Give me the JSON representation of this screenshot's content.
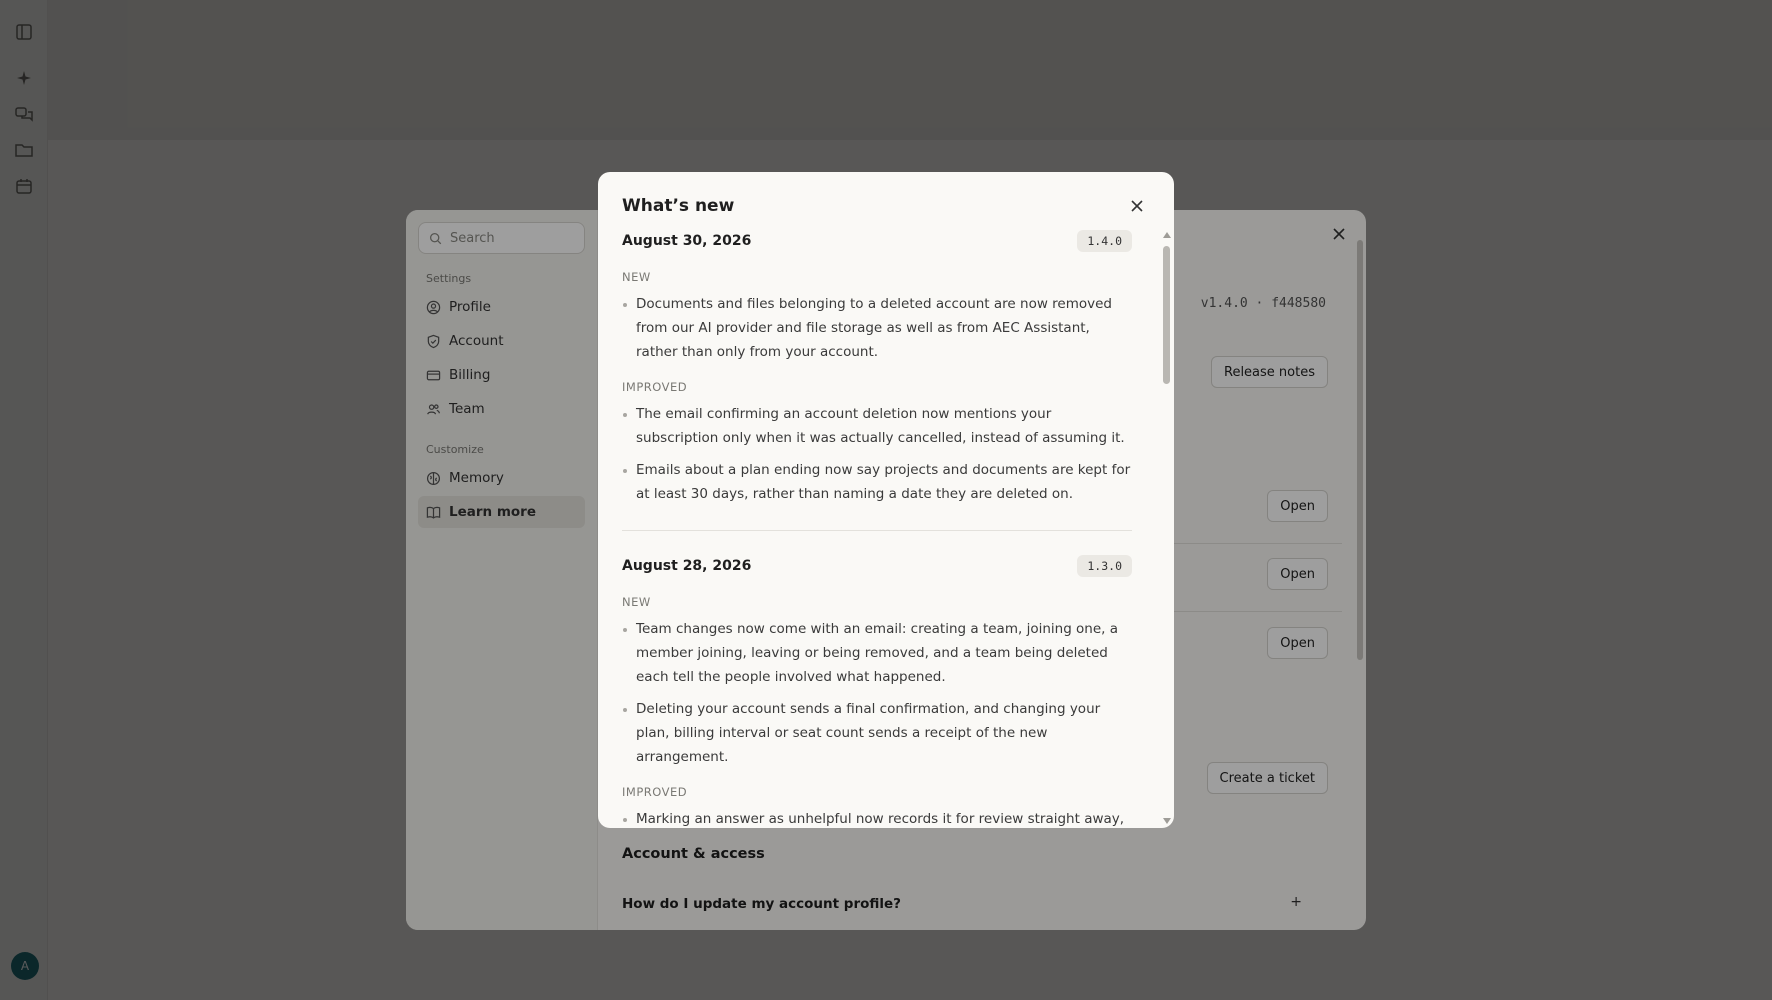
{
  "app": {
    "avatar_initial": "A",
    "rail_icons": [
      "sidebar-toggle-icon",
      "sparkle-icon",
      "chat-bubbles-icon",
      "folder-icon",
      "calendar-icon"
    ]
  },
  "settings": {
    "search_placeholder": "Search",
    "sections": [
      {
        "label": "Settings",
        "items": [
          {
            "label": "Profile",
            "icon": "user-circle-icon"
          },
          {
            "label": "Account",
            "icon": "shield-icon"
          },
          {
            "label": "Billing",
            "icon": "credit-card-icon"
          },
          {
            "label": "Team",
            "icon": "users-icon"
          }
        ]
      },
      {
        "label": "Customize",
        "items": [
          {
            "label": "Memory",
            "icon": "brain-icon"
          },
          {
            "label": "Learn more",
            "icon": "book-icon",
            "active": true
          }
        ]
      }
    ],
    "version": "v1.4.0 · f448580",
    "release_notes_label": "Release notes",
    "open_label": "Open",
    "create_ticket_label": "Create a ticket",
    "faq_section_title": "Account & access",
    "faq_question": "How do I update my account profile?",
    "faq_expand": "+"
  },
  "whats_new": {
    "title": "What’s new",
    "releases": [
      {
        "date": "August 30, 2026",
        "version": "1.4.0",
        "groups": [
          {
            "label": "NEW",
            "items": [
              "Documents and files belonging to a deleted account are now removed from our AI provider and file storage as well as from AEC Assistant, rather than only from your account."
            ]
          },
          {
            "label": "IMPROVED",
            "items": [
              "The email confirming an account deletion now mentions your subscription only when it was actually cancelled, instead of assuming it.",
              "Emails about a plan ending now say projects and documents are kept for at least 30 days, rather than naming a date they are deleted on."
            ]
          }
        ]
      },
      {
        "date": "August 28, 2026",
        "version": "1.3.0",
        "groups": [
          {
            "label": "NEW",
            "items": [
              "Team changes now come with an email: creating a team, joining one, a member joining, leaving or being removed, and a team being deleted each tell the people involved what happened.",
              "Deleting your account sends a final confirmation, and changing your plan, billing interval or seat count sends a receipt of the new arrangement."
            ]
          },
          {
            "label": "IMPROVED",
            "items": [
              "Marking an answer as unhelpful now records it for review straight away, with the conversation attached."
            ]
          }
        ]
      }
    ]
  }
}
